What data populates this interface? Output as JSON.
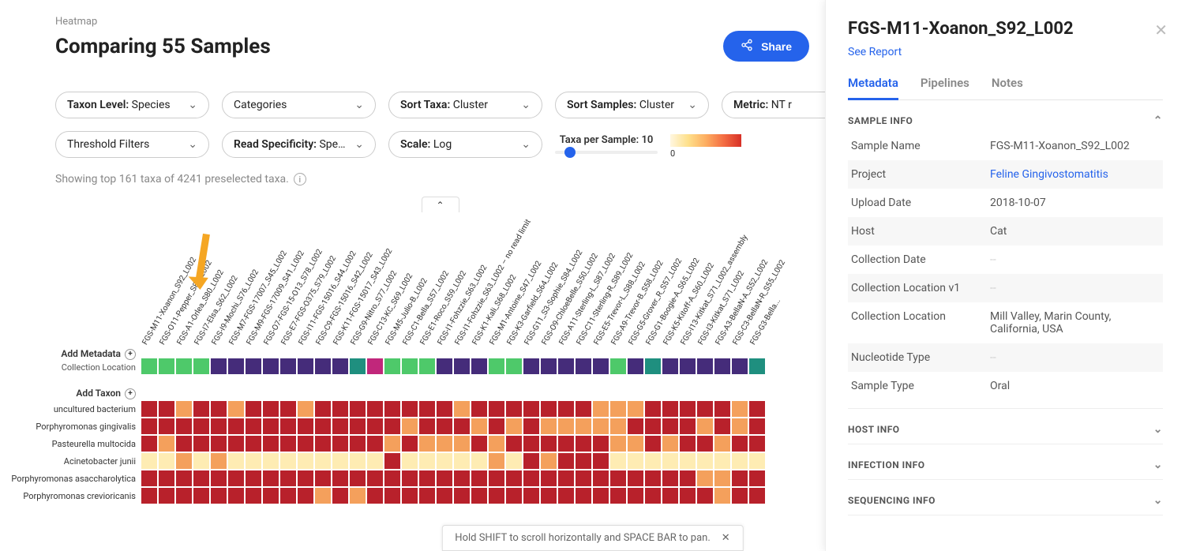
{
  "breadcrumb": "Heatmap",
  "page_title": "Comparing 55 Samples",
  "share_label": "Share",
  "filters": {
    "taxon_level": {
      "key": "Taxon Level:",
      "val": "Species"
    },
    "categories": {
      "key": "Categories",
      "val": ""
    },
    "sort_taxa": {
      "key": "Sort Taxa:",
      "val": "Cluster"
    },
    "sort_samples": {
      "key": "Sort Samples:",
      "val": "Cluster"
    },
    "metric": {
      "key": "Metric:",
      "val": "NT r"
    },
    "threshold": {
      "key": "Threshold Filters",
      "val": ""
    },
    "read_spec": {
      "key": "Read Specificity:",
      "val": "Spec..."
    },
    "scale": {
      "key": "Scale:",
      "val": "Log"
    },
    "taxa_per_sample": {
      "label": "Taxa per Sample:",
      "val": "10"
    }
  },
  "status_line": "Showing top 161 taxa of 4241 preselected taxa.",
  "add_metadata": "Add Metadata",
  "collection_location_label": "Collection Location",
  "add_taxon": "Add Taxon",
  "legend_min": "0",
  "chart_data": {
    "type": "heatmap",
    "samples": [
      "FGS-M11-Xoanon_S92_L002",
      "FGS-O11-Pepper_S81_L002",
      "FGS-A1-Orlea_S80_L002",
      "FGS-I7-Elsa_S62_L002",
      "FGS-I9-Mochi_S76_L002",
      "FGS-M7-FGS-17007_S45_L002",
      "FGS-M9-FGS-17009_S41_L002",
      "FGS-O7-FGS-15-O13_S78_L002",
      "FGS-E7-FGS-O375_S79_L002",
      "FGS-I11-FGS-15016_S44_L002",
      "FGS-C9-FGS-15016_S42_L002",
      "FGS-K11-FGS-15017_S43_L002",
      "FGS-G9-Nitro_S77_L002",
      "FGS-C13-KC_S69_L002",
      "FGS-M5-Julio-B_L002",
      "FGS-C1-Bella_S57_L002",
      "FGS-E1-Roco_S59_L002",
      "FGS-I1-Fohzzie_S63_L002",
      "FGS-I1-Fohzzie_S63_L002 – no read limit",
      "FGS-K1-Kali_S68_L002",
      "FGS-M1-Antoine_S47_L002",
      "FGS-K3-Garfield_S64_L002",
      "FGS-G11_S3-Sophie_S84_L002",
      "FGS-O9-ChloeBelle_S50_L002",
      "FGS-A11-Sterling-L_S87_L002",
      "FGS-C11-Sterling-R_S89_L002",
      "FGS-E5-Trevor-L_S88_L002",
      "FGS-A9-Trevor-B_S58_L002",
      "FGS-G5-Grover_R_S57_L002",
      "FGS-G1-Boogie-A_S65_L002",
      "FGS-K5-Kitoff-A_S60_L002",
      "FGS-I13-Kitkat_S71_L002_assembly",
      "FGS-I3-Kitkat_S71_L002",
      "FGS-A3-BellaN-A_S52_L002",
      "FGS-C3-BellaN-R_S55_L002",
      "FGS-G3-Bella..."
    ],
    "collection_location_colors": [
      "#4ec96a",
      "#4ec96a",
      "#4ec96a",
      "#4ec96a",
      "#452c7a",
      "#452c7a",
      "#452c7a",
      "#452c7a",
      "#452c7a",
      "#452c7a",
      "#452c7a",
      "#452c7a",
      "#1f8f7f",
      "#c1277b",
      "#4ec96a",
      "#4ec96a",
      "#4ec96a",
      "#452c7a",
      "#452c7a",
      "#452c7a",
      "#4ec96a",
      "#4ec96a",
      "#452c7a",
      "#452c7a",
      "#452c7a",
      "#452c7a",
      "#452c7a",
      "#4ec96a",
      "#452c7a",
      "#1f8f7f",
      "#452c7a",
      "#452c7a",
      "#452c7a",
      "#452c7a",
      "#452c7a",
      "#1f8f7f"
    ],
    "taxa": [
      "uncultured bacterium",
      "Porphyromonas gingivalis",
      "Pasteurella multocida",
      "Acinetobacter junii",
      "Porphyromonas asaccharolytica",
      "Porphyromonas crevioricanis"
    ],
    "values": [
      [
        3,
        3,
        2,
        3,
        3,
        2,
        3,
        3,
        3,
        2,
        3,
        3,
        3,
        3,
        3,
        3,
        3,
        3,
        2,
        3,
        3,
        3,
        3,
        3,
        3,
        3,
        2,
        2,
        2,
        3,
        3,
        3,
        3,
        3,
        2,
        3
      ],
      [
        3,
        3,
        3,
        3,
        3,
        3,
        3,
        3,
        3,
        3,
        3,
        3,
        3,
        3,
        3,
        2,
        3,
        3,
        3,
        2,
        3,
        2,
        3,
        2,
        2,
        2,
        2,
        2,
        3,
        3,
        3,
        3,
        2,
        3,
        2,
        3
      ],
      [
        3,
        2,
        3,
        3,
        3,
        3,
        3,
        3,
        3,
        3,
        3,
        3,
        3,
        3,
        2,
        3,
        2,
        2,
        2,
        3,
        2,
        3,
        3,
        3,
        3,
        3,
        3,
        2,
        2,
        3,
        2,
        3,
        3,
        2,
        3,
        3
      ],
      [
        1,
        1,
        2,
        1,
        2,
        1,
        1,
        1,
        1,
        1,
        1,
        1,
        1,
        1,
        3,
        1,
        1,
        1,
        1,
        1,
        2,
        1,
        3,
        2,
        3,
        3,
        3,
        1,
        1,
        1,
        1,
        1,
        1,
        1,
        1,
        1
      ],
      [
        3,
        3,
        3,
        3,
        3,
        3,
        3,
        3,
        3,
        3,
        3,
        3,
        3,
        3,
        3,
        3,
        3,
        3,
        3,
        3,
        3,
        3,
        3,
        3,
        3,
        3,
        3,
        3,
        3,
        3,
        3,
        3,
        2,
        2,
        3,
        3
      ],
      [
        3,
        3,
        3,
        3,
        3,
        3,
        3,
        3,
        3,
        3,
        2,
        3,
        2,
        3,
        3,
        3,
        3,
        3,
        3,
        3,
        3,
        3,
        3,
        3,
        3,
        3,
        3,
        3,
        3,
        3,
        3,
        3,
        3,
        2,
        3,
        3
      ]
    ],
    "value_colors": {
      "1": "#feecb3",
      "2": "#f4a05c",
      "3": "#b8212b"
    }
  },
  "toast": "Hold SHIFT to scroll horizontally and SPACE BAR to pan.",
  "panel": {
    "title": "FGS-M11-Xoanon_S92_L002",
    "link": "See Report",
    "tabs": [
      "Metadata",
      "Pipelines",
      "Notes"
    ],
    "active_tab": 0,
    "sections": [
      {
        "title": "SAMPLE INFO",
        "expanded": true,
        "rows": [
          {
            "k": "Sample Name",
            "v": "FGS-M11-Xoanon_S92_L002"
          },
          {
            "k": "Project",
            "v": "Feline Gingivostomatitis",
            "link": true
          },
          {
            "k": "Upload Date",
            "v": "2018-10-07"
          },
          {
            "k": "Host",
            "v": "Cat"
          },
          {
            "k": "Collection Date",
            "v": "--",
            "dash": true
          },
          {
            "k": "Collection Location v1",
            "v": "--",
            "dash": true
          },
          {
            "k": "Collection Location",
            "v": "Mill Valley, Marin County, California, USA"
          },
          {
            "k": "Nucleotide Type",
            "v": "--",
            "dash": true
          },
          {
            "k": "Sample Type",
            "v": "Oral"
          }
        ]
      },
      {
        "title": "HOST INFO",
        "expanded": false
      },
      {
        "title": "INFECTION INFO",
        "expanded": false
      },
      {
        "title": "SEQUENCING INFO",
        "expanded": false
      }
    ]
  }
}
